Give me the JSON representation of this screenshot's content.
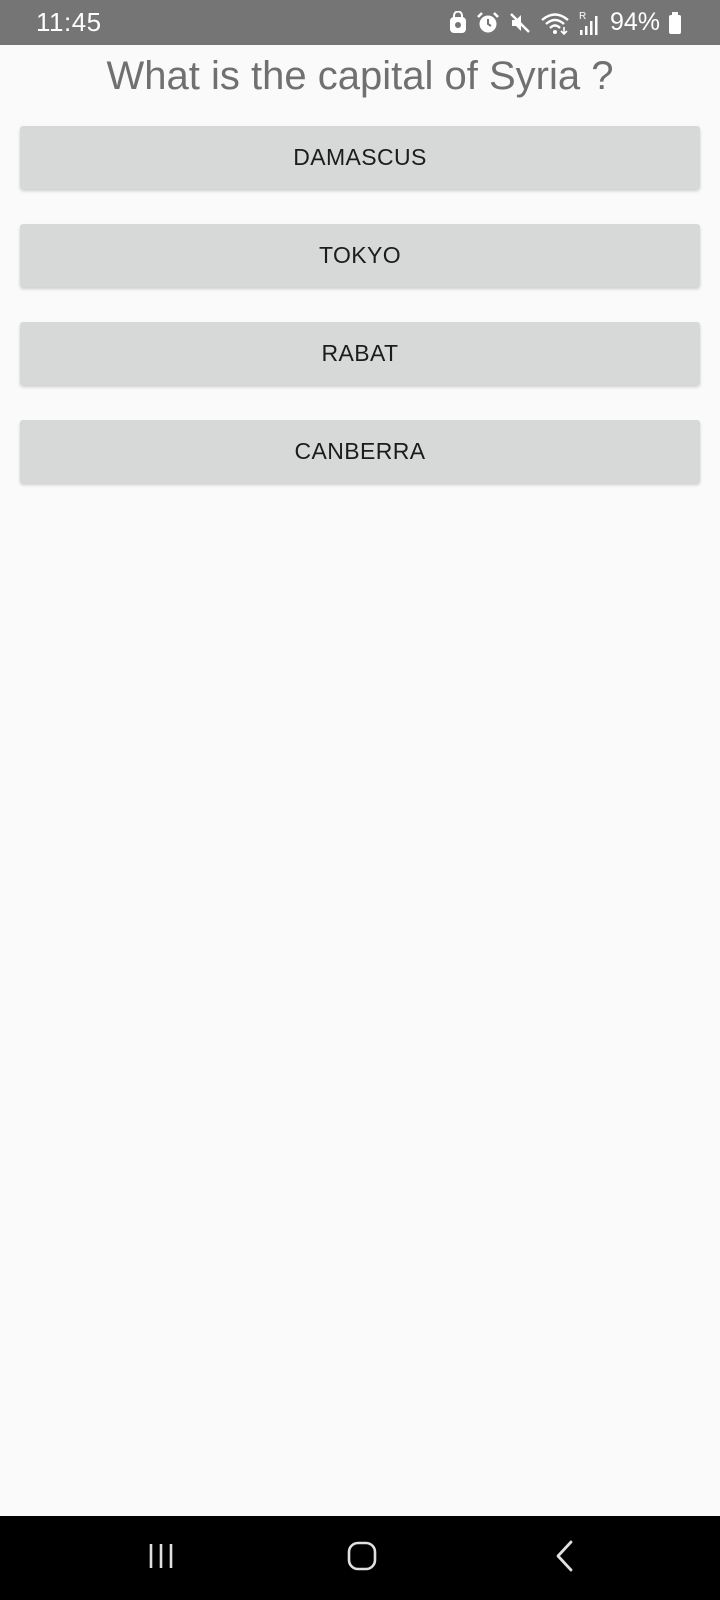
{
  "status_bar": {
    "time": "11:45",
    "battery_percent": "94%",
    "icons": [
      "lock-icon",
      "alarm-icon",
      "mute-icon",
      "wifi-icon",
      "signal-icon",
      "battery-icon"
    ]
  },
  "quiz": {
    "question": "What is the capital of Syria ?",
    "answers": [
      {
        "label": "DAMASCUS"
      },
      {
        "label": "TOKYO"
      },
      {
        "label": "RABAT"
      },
      {
        "label": "CANBERRA"
      }
    ]
  },
  "nav_bar": {
    "buttons": [
      "recent-apps",
      "home",
      "back"
    ]
  },
  "colors": {
    "status_bar_bg": "#757575",
    "background": "#fafafa",
    "button_bg": "#d7d8d8",
    "question_text": "#707070",
    "nav_bar_bg": "#000000"
  }
}
